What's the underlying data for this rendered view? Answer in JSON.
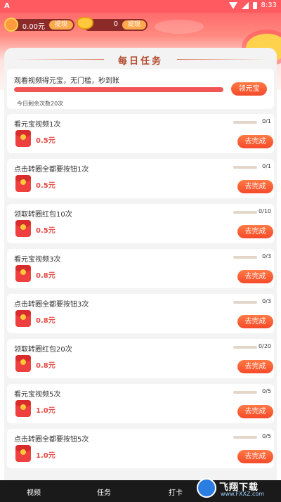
{
  "statusbar": {
    "time": "8:33",
    "app_letter": "A"
  },
  "header": {
    "wallet_cash": {
      "amount": "0.00元",
      "button": "提现"
    },
    "wallet_gold": {
      "amount": "0",
      "button": "提现"
    }
  },
  "card": {
    "title": "每日任务"
  },
  "featured": {
    "title": "观看视频得元宝，无门槛，秒到账",
    "progress": 1.0,
    "remaining": "今日剩余次数20次",
    "button": "领元宝"
  },
  "tasks": [
    {
      "title": "看元宝视频1次",
      "reward": "0.5元",
      "count": "0/1",
      "button": "去完成"
    },
    {
      "title": "点击转圈全都要按钮1次",
      "reward": "0.5元",
      "count": "0/1",
      "button": "去完成"
    },
    {
      "title": "领取转圈红包10次",
      "reward": "0.5元",
      "count": "0/10",
      "button": "去完成"
    },
    {
      "title": "看元宝视频3次",
      "reward": "0.8元",
      "count": "0/3",
      "button": "去完成"
    },
    {
      "title": "点击转圈全都要按钮3次",
      "reward": "0.8元",
      "count": "0/3",
      "button": "去完成"
    },
    {
      "title": "领取转圈红包20次",
      "reward": "0.8元",
      "count": "0/20",
      "button": "去完成"
    },
    {
      "title": "看元宝视频5次",
      "reward": "1.0元",
      "count": "0/5",
      "button": "去完成"
    },
    {
      "title": "点击转圈全都要按钮5次",
      "reward": "1.0元",
      "count": "0/5",
      "button": "去完成"
    }
  ],
  "nav": {
    "items": [
      "视频",
      "任务",
      "打卡"
    ],
    "active": "任务"
  },
  "watermark": {
    "text": "飞翔下载",
    "url": "www.FXXZ.com"
  }
}
